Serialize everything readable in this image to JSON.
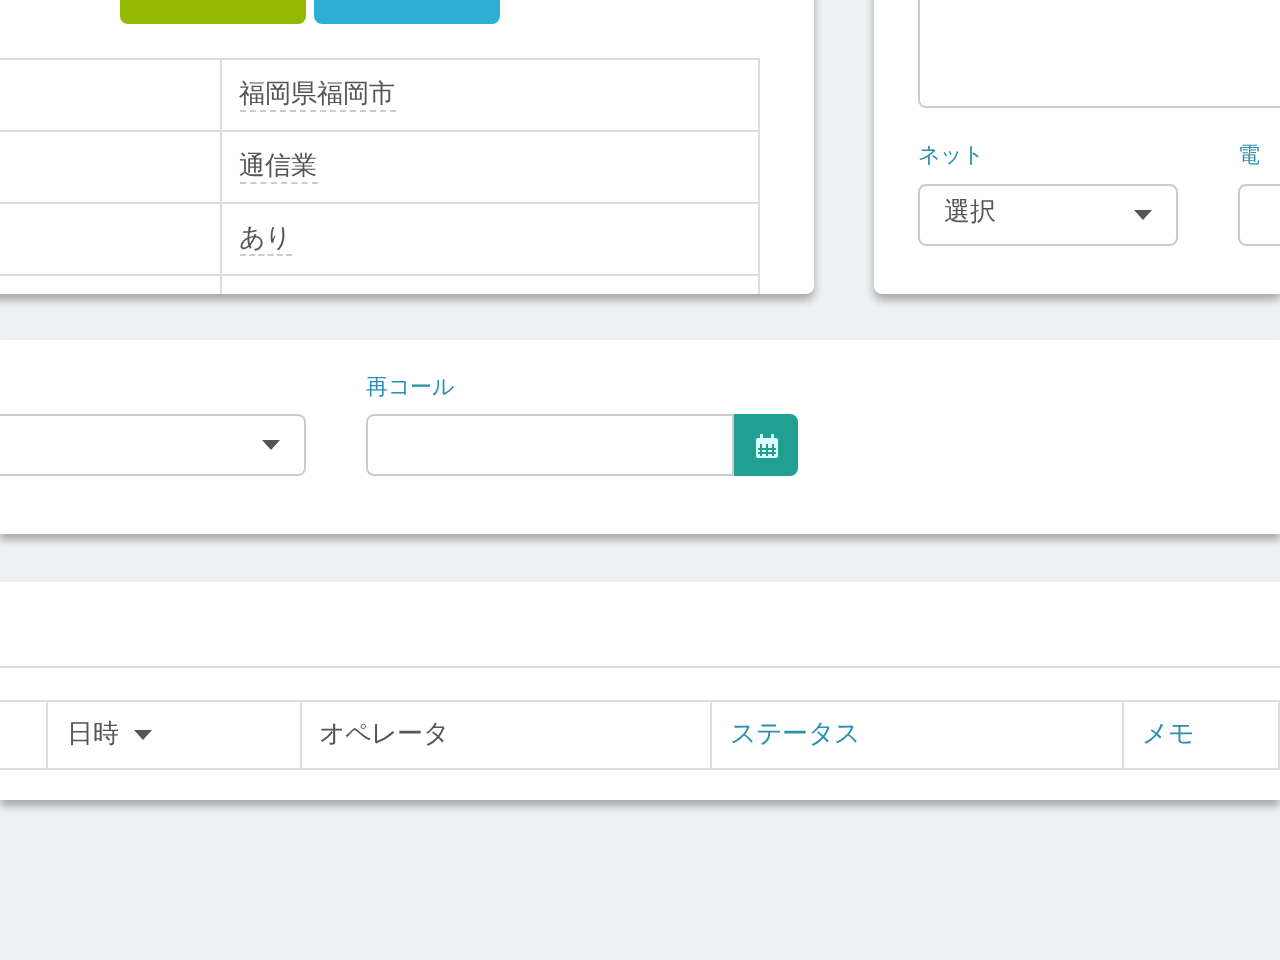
{
  "info_table": {
    "rows": [
      {
        "value": "福岡県福岡市"
      },
      {
        "value": "通信業"
      },
      {
        "value": "あり"
      },
      {}
    ]
  },
  "side_form": {
    "fields": [
      {
        "label": "ネット",
        "value": "選択"
      },
      {
        "label": "電"
      }
    ]
  },
  "recall_form": {
    "label": "再コール"
  },
  "history": {
    "columns": [
      {
        "kind": "plain"
      },
      {
        "label": "日時",
        "kind": "sort"
      },
      {
        "label": "オペレータ",
        "kind": "plain"
      },
      {
        "label": "ステータス",
        "kind": "link"
      },
      {
        "label": "メモ",
        "kind": "link"
      }
    ]
  }
}
